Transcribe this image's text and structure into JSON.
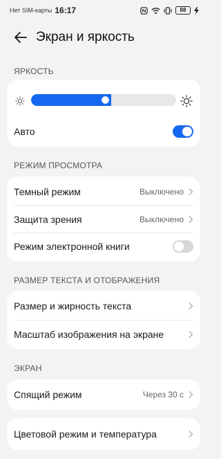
{
  "status_bar": {
    "carrier": "Нет SIM-карты",
    "time": "16:17",
    "battery": "88",
    "icons": [
      "nfc-icon",
      "wifi-icon",
      "vibrate-icon",
      "battery-icon",
      "charging-icon"
    ]
  },
  "header": {
    "title": "Экран и яркость",
    "back_icon": "arrow-left-icon"
  },
  "brightness": {
    "section_label": "ЯРКОСТЬ",
    "level_percent": 55,
    "auto_label": "Авто",
    "auto_enabled": true
  },
  "view_mode": {
    "section_label": "РЕЖИМ ПРОСМОТРА",
    "items": [
      {
        "label": "Темный режим",
        "value": "Выключено"
      },
      {
        "label": "Защита зрения",
        "value": "Выключено"
      },
      {
        "label": "Режим электронной книги",
        "enabled": false
      }
    ]
  },
  "text_display": {
    "section_label": "РАЗМЕР ТЕКСТА И ОТОБРАЖЕНИЯ",
    "items": [
      {
        "label": "Размер и жирность текста"
      },
      {
        "label": "Масштаб изображения на экране"
      }
    ]
  },
  "screen": {
    "section_label": "ЭКРАН",
    "sleep": {
      "label": "Спящий режим",
      "value": "Через 30 с"
    },
    "color": {
      "label": "Цветовой режим и температура"
    }
  },
  "colors": {
    "accent": "#1468f0",
    "background": "#f1f3f5",
    "card": "#ffffff"
  }
}
